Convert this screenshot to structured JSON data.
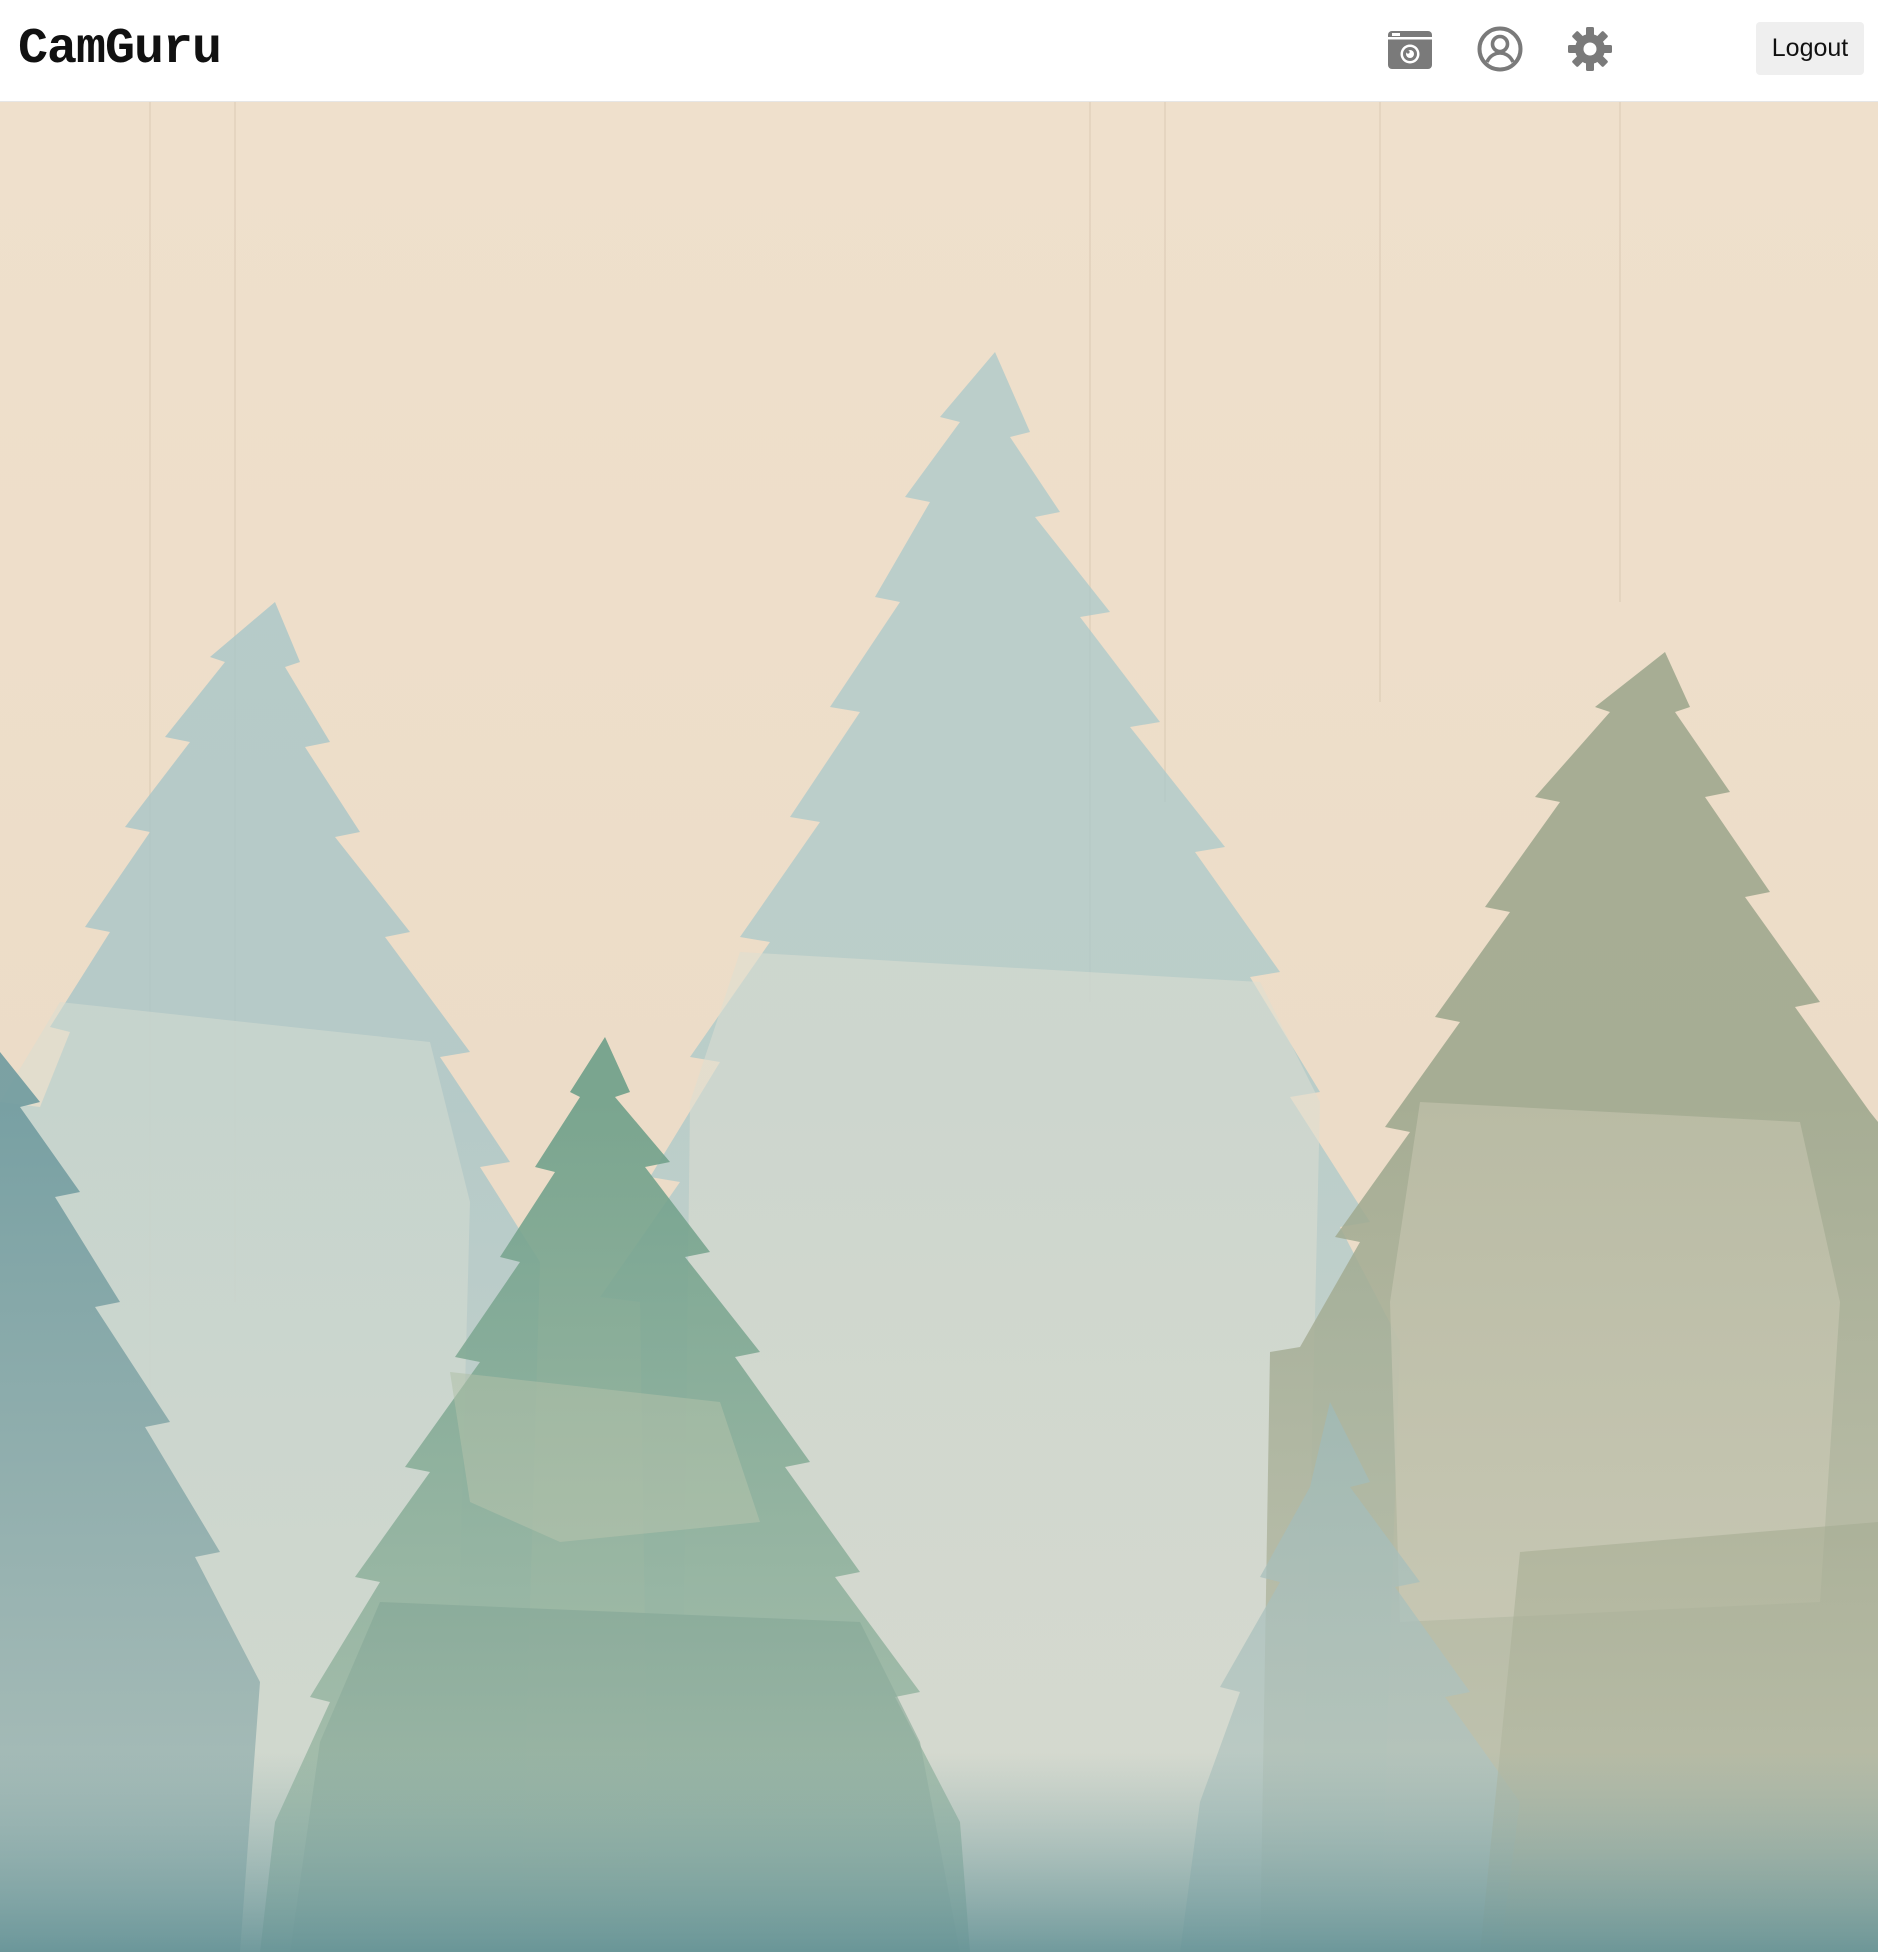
{
  "app": {
    "logo_text": "CamGuru"
  },
  "header": {
    "icons": [
      "camera-icon",
      "user-circle-icon",
      "gear-icon"
    ],
    "logout_label": "Logout"
  },
  "background": {
    "description_type": "watercolor-pine-forest-illustration",
    "colors": {
      "sky": "#f0dfca",
      "pale_blue_tree": "#a9c8c9",
      "teal_tree": "#6f9f9c",
      "green_tree": "#5d8f7a",
      "olive_tree": "#9ba58b"
    }
  }
}
